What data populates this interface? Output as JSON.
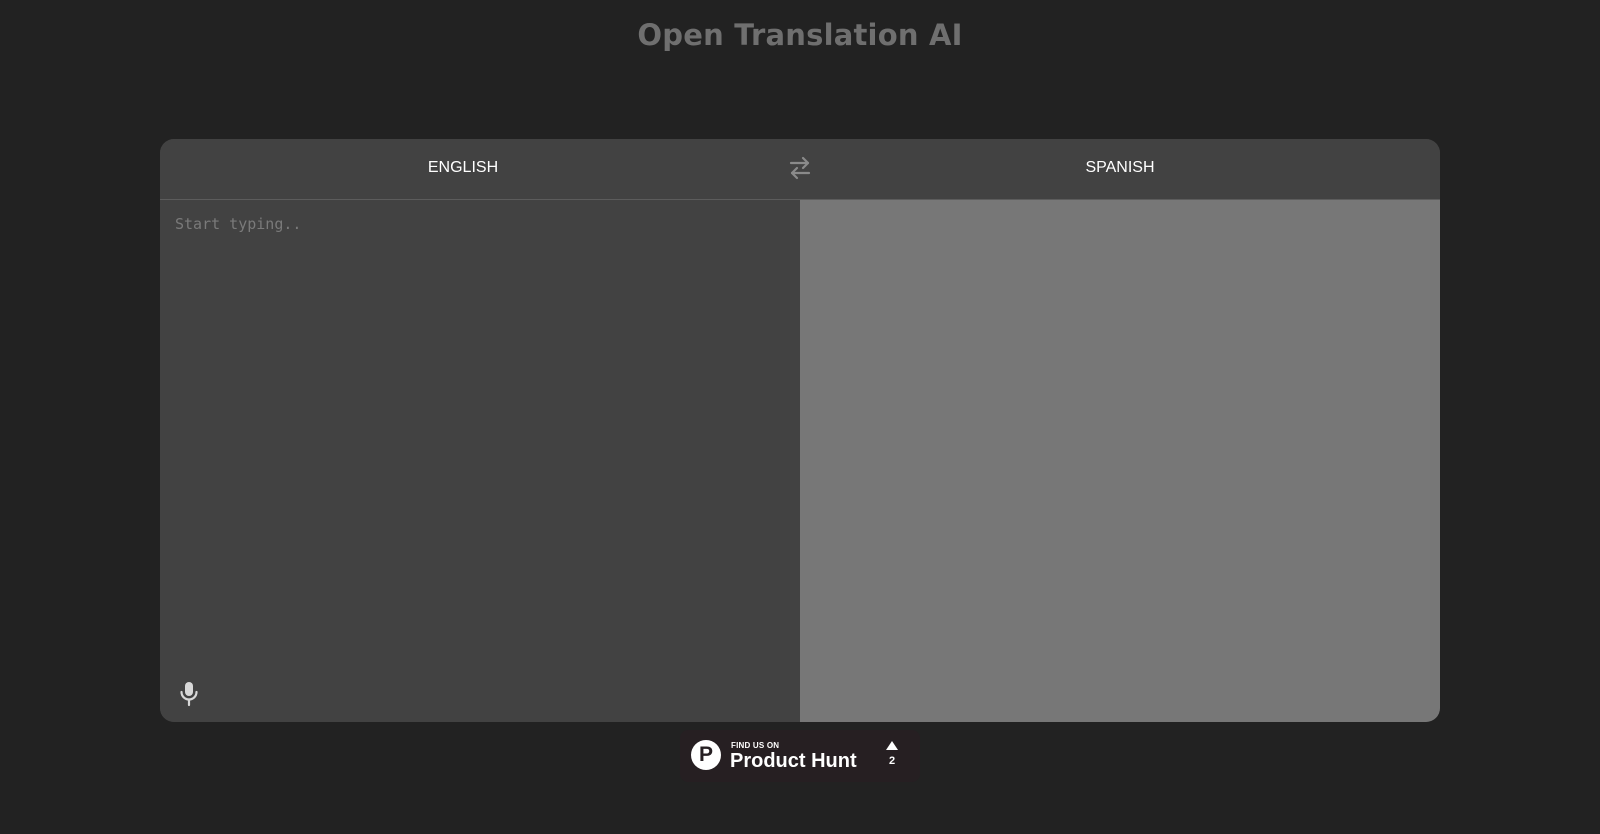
{
  "header": {
    "title": "Open Translation AI"
  },
  "translator": {
    "source_language": "ENGLISH",
    "target_language": "SPANISH",
    "source_input": {
      "value": "",
      "placeholder": "Start typing.."
    },
    "target_output": "",
    "swap_icon": "swap-arrows-icon",
    "mic_icon": "microphone-icon"
  },
  "badge": {
    "find_text": "FIND US ON",
    "name": "Product Hunt",
    "logo_letter": "P",
    "upvotes": "2",
    "upvote_icon": "triangle-up-icon"
  },
  "colors": {
    "background": "#222222",
    "panel": "#424242",
    "output_pane": "#777777",
    "title": "#6f6f6f",
    "badge_bg": "#261f22"
  }
}
